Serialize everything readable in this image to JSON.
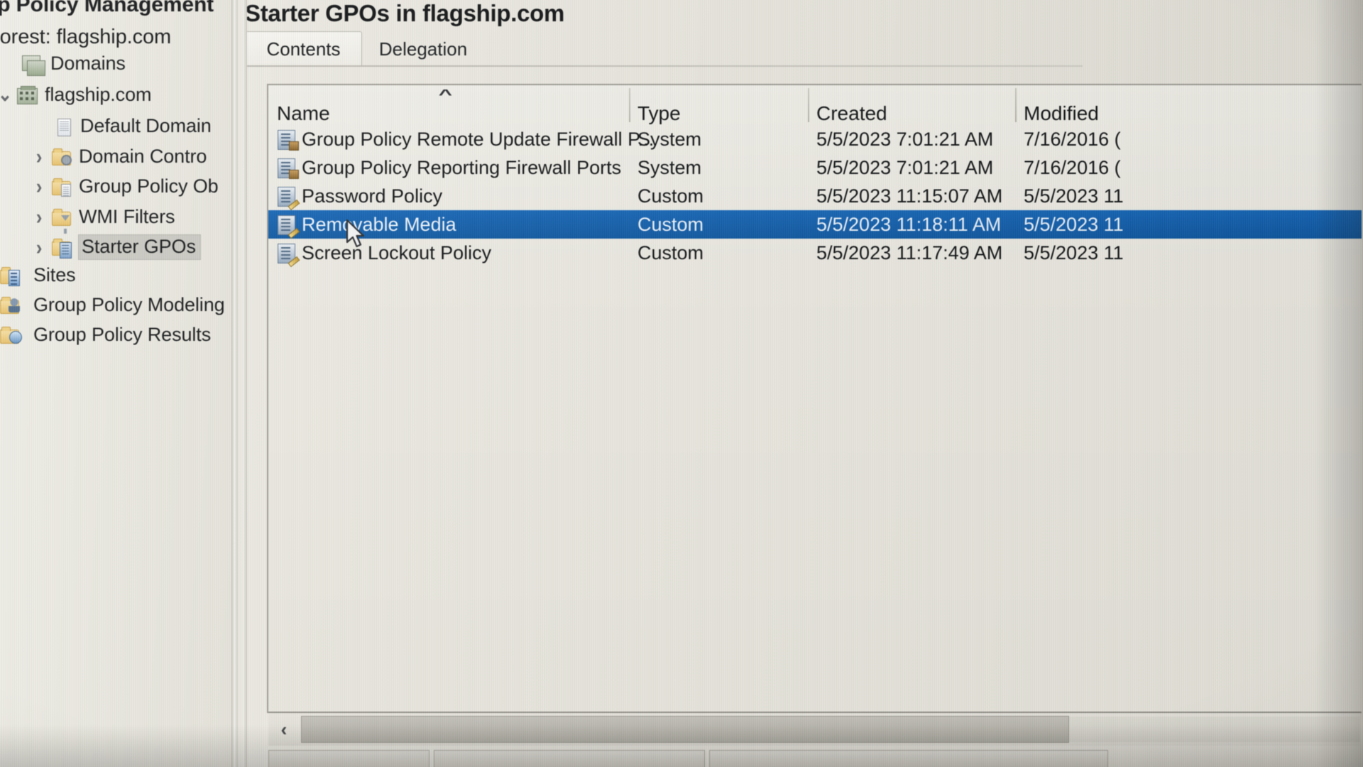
{
  "window": {
    "app_title": "up Policy Management",
    "forest_label": "Forest: flagship.com"
  },
  "sidebar": {
    "items": [
      {
        "label": "Domains",
        "icon": "domains-stack-icon",
        "indent": 0,
        "chevron": "",
        "selected": false
      },
      {
        "label": "flagship.com",
        "icon": "domain-icon",
        "indent": 1,
        "chevron": "v",
        "selected": false
      },
      {
        "label": "Default Domain",
        "icon": "gpo-link-icon",
        "indent": 2,
        "chevron": "",
        "selected": false
      },
      {
        "label": "Domain Contro",
        "icon": "ou-folder-icon",
        "indent": 2,
        "chevron": ">",
        "selected": false
      },
      {
        "label": "Group Policy Ob",
        "icon": "gpo-folder-icon",
        "indent": 2,
        "chevron": ">",
        "selected": false
      },
      {
        "label": "WMI Filters",
        "icon": "wmi-filter-folder-icon",
        "indent": 2,
        "chevron": ">",
        "selected": false
      },
      {
        "label": "Starter GPOs",
        "icon": "starter-gpo-folder-icon",
        "indent": 2,
        "chevron": ">",
        "selected": true
      },
      {
        "label": "Sites",
        "icon": "sites-icon",
        "indent": 0,
        "chevron": "",
        "selected": false
      },
      {
        "label": "Group Policy Modeling",
        "icon": "gp-modeling-icon",
        "indent": 0,
        "chevron": "",
        "selected": false
      },
      {
        "label": "Group Policy Results",
        "icon": "gp-results-icon",
        "indent": 0,
        "chevron": "",
        "selected": false
      }
    ]
  },
  "main": {
    "title": "Starter GPOs in flagship.com",
    "tabs": [
      {
        "label": "Contents",
        "active": true
      },
      {
        "label": "Delegation",
        "active": false
      }
    ],
    "table": {
      "columns": [
        "Name",
        "Type",
        "Created",
        "Modified"
      ],
      "sort_column": "Name",
      "sort_direction": "ascending",
      "sort_indicator": "^",
      "rows": [
        {
          "name": "Group Policy Remote Update Firewall P...",
          "type": "System",
          "created": "5/5/2023 7:01:21 AM",
          "modified": "7/16/2016 (",
          "icon": "starter-gpo-system-icon",
          "selected": false
        },
        {
          "name": "Group Policy Reporting Firewall Ports",
          "type": "System",
          "created": "5/5/2023 7:01:21 AM",
          "modified": "7/16/2016 (",
          "icon": "starter-gpo-system-icon",
          "selected": false
        },
        {
          "name": "Password Policy",
          "type": "Custom",
          "created": "5/5/2023 11:15:07 AM",
          "modified": "5/5/2023 11",
          "icon": "starter-gpo-custom-icon",
          "selected": false
        },
        {
          "name": "Removable Media",
          "type": "Custom",
          "created": "5/5/2023 11:18:11 AM",
          "modified": "5/5/2023 11",
          "icon": "starter-gpo-custom-icon",
          "selected": true
        },
        {
          "name": "Screen Lockout Policy",
          "type": "Custom",
          "created": "5/5/2023 11:17:49 AM",
          "modified": "5/5/2023 11",
          "icon": "starter-gpo-custom-icon",
          "selected": false
        }
      ]
    },
    "scrollbar": {
      "left_arrow": "‹",
      "right_arrow": "›"
    }
  },
  "colors": {
    "selection_blue": "#1267bd",
    "selection_text": "#eef4fb",
    "window_bg": "#e8e6de",
    "tree_selected_bg": "#c9c8c0",
    "text": "#111416"
  }
}
